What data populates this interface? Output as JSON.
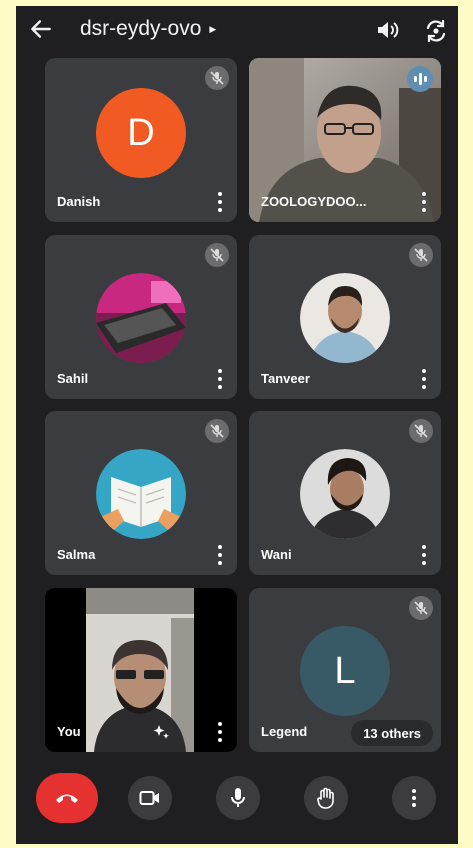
{
  "meeting": {
    "code": "dsr-eydy-ovo"
  },
  "participants": [
    {
      "name": "Danish",
      "avatar_letter": "D",
      "avatar_color": "#f15a22",
      "muted": true
    },
    {
      "name": "ZOOLOGYDOO...",
      "video": true,
      "speaking": true
    },
    {
      "name": "Sahil",
      "muted": true
    },
    {
      "name": "Tanveer",
      "muted": true
    },
    {
      "name": "Salma",
      "muted": true
    },
    {
      "name": "Wani",
      "muted": true
    },
    {
      "name": "You",
      "video": true
    },
    {
      "name": "Legend",
      "avatar_letter": "L",
      "avatar_color": "#385966",
      "muted": true,
      "others": "13 others"
    }
  ],
  "controls": [
    "end-call",
    "camera",
    "microphone",
    "raise-hand",
    "more-options"
  ],
  "colors": {
    "end_call": "#e5312f",
    "active_border": "#67a2c7",
    "tile": "#3b3c3f",
    "background": "#1f1f21"
  }
}
